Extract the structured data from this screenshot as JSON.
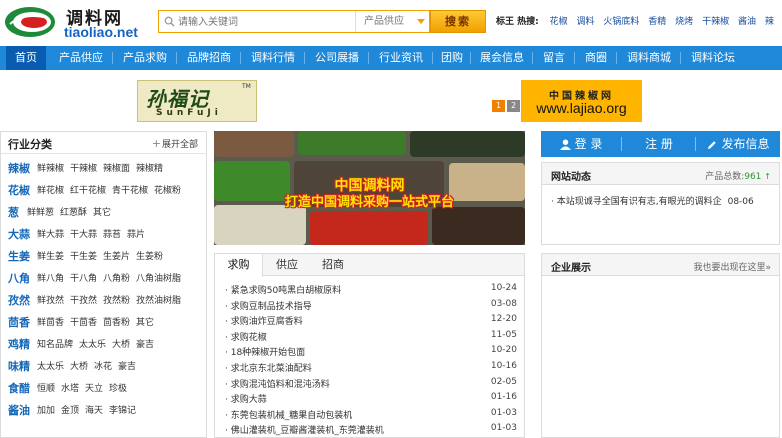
{
  "header": {
    "logo_cn": "调料网",
    "logo_en": "tiaoliao.net",
    "search_placeholder": "请输入关键词",
    "search_type": "产品供应",
    "search_button": "搜索",
    "hot_label": "标王 热搜:",
    "hot_words": [
      "花椒",
      "调料",
      "火锅底料",
      "香精",
      "烧烤",
      "干辣椒",
      "酱油",
      "辣"
    ]
  },
  "nav": {
    "items": [
      "首页",
      "产品供应",
      "产品求购",
      "品牌招商",
      "调料行情",
      "公司展播",
      "行业资讯",
      "团购",
      "展会信息",
      "留言",
      "商圈",
      "调料商城",
      "调料论坛"
    ]
  },
  "banners": {
    "left_cn": "孙福记",
    "left_en": "SunFuJi",
    "left_tm": "TM",
    "right_cn": "中国辣椒网",
    "right_url": "www.lajiao.org"
  },
  "categories": {
    "title": "行业分类",
    "expand_label": "展开全部",
    "rows": [
      {
        "name": "辣椒",
        "items": [
          "鲜辣椒",
          "干辣椒",
          "辣椒面",
          "辣椒精"
        ]
      },
      {
        "name": "花椒",
        "items": [
          "鲜花椒",
          "红干花椒",
          "青干花椒",
          "花椒粉"
        ]
      },
      {
        "name": "葱",
        "items": [
          "鲜鲜葱",
          "红葱酥",
          "其它"
        ]
      },
      {
        "name": "大蒜",
        "items": [
          "鲜大蒜",
          "干大蒜",
          "蒜苔",
          "蒜片"
        ]
      },
      {
        "name": "生姜",
        "items": [
          "鲜生姜",
          "干生姜",
          "生姜片",
          "生姜粉"
        ]
      },
      {
        "name": "八角",
        "items": [
          "鲜八角",
          "干八角",
          "八角粉",
          "八角油树脂"
        ]
      },
      {
        "name": "孜然",
        "items": [
          "鲜孜然",
          "干孜然",
          "孜然粉",
          "孜然油树脂"
        ]
      },
      {
        "name": "茴香",
        "items": [
          "鲜茴香",
          "干茴香",
          "茴香粉",
          "其它"
        ]
      },
      {
        "name": "鸡精",
        "items": [
          "知名品牌",
          "太太乐",
          "大桥",
          "豪吉"
        ]
      },
      {
        "name": "味精",
        "items": [
          "太太乐",
          "大桥",
          "冰花",
          "豪吉"
        ]
      },
      {
        "name": "食醋",
        "items": [
          "恒顺",
          "水塔",
          "天立",
          "珍极"
        ]
      },
      {
        "name": "酱油",
        "items": [
          "加加",
          "金顶",
          "海天",
          "李锦记"
        ]
      }
    ]
  },
  "slide": {
    "title": "中国调料网",
    "subtitle": "打造中国调料采购一站式平台",
    "dots": [
      "1",
      "2"
    ]
  },
  "tabs": {
    "labels": [
      "求购",
      "供应",
      "招商"
    ],
    "rows": [
      {
        "text": "· 紧急求购50吨黑白胡椒原料",
        "date": "10-24"
      },
      {
        "text": "· 求购豆制品技术指导",
        "date": "03-08"
      },
      {
        "text": "· 求购油炸豆腐香料",
        "date": "12-20"
      },
      {
        "text": "· 求购花椒",
        "date": "11-05"
      },
      {
        "text": "· 18种辣椒开始包面",
        "date": "10-20"
      },
      {
        "text": "· 求北京东北菜油配料",
        "date": "10-16"
      },
      {
        "text": "· 求购混沌馅料和混沌汤料",
        "date": "02-05"
      },
      {
        "text": "· 求购大蒜",
        "date": "01-16"
      },
      {
        "text": "· 东莞包装机械_糖果自动包装机",
        "date": "01-03"
      },
      {
        "text": "· 佛山灌装机_豆瓣酱灌装机_东莞灌装机",
        "date": "01-03"
      }
    ]
  },
  "actions": {
    "login": "登 录",
    "register": "注 册",
    "publish": "发布信息"
  },
  "news": {
    "title": "网站动态",
    "total_label": "产品总数:",
    "total_value": "961",
    "up_arrow": "↑",
    "item_text": "· 本站现诚寻全国有识有志,有眼光的调料企",
    "item_date": "08-06"
  },
  "showcase": {
    "title": "企业展示",
    "link": "我也要出现在这里»"
  },
  "colors": {
    "nav_blue": "#1f88d8",
    "nav_active": "#0a5cb0",
    "search_orange": "#f0a000",
    "category_blue": "#1568b8"
  }
}
